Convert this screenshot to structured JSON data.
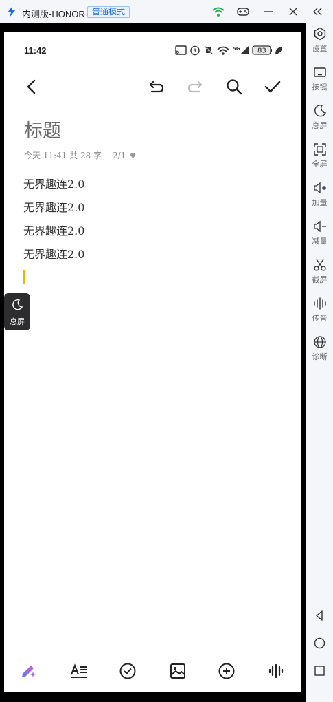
{
  "titlebar": {
    "title": "内测版-HONOR",
    "mode_badge": "普通模式"
  },
  "status_bar": {
    "time": "11:42",
    "battery": "83"
  },
  "note": {
    "title": "标题",
    "meta_time": "今天 11:41",
    "meta_count": "共 28 字",
    "meta_page": "2/1",
    "lines": [
      "无界趣连2.0",
      "无界趣连2.0",
      "无界趣连2.0",
      "无界趣连2.0"
    ]
  },
  "floating_button": {
    "label": "息屏"
  },
  "side_panel": {
    "items": [
      {
        "label": "设置",
        "icon": "settings-icon"
      },
      {
        "label": "按键",
        "icon": "keyboard-icon"
      },
      {
        "label": "息屏",
        "icon": "moon-icon"
      },
      {
        "label": "全屏",
        "icon": "fullscreen-icon"
      },
      {
        "label": "加量",
        "icon": "volume-up-icon"
      },
      {
        "label": "减量",
        "icon": "volume-down-icon"
      },
      {
        "label": "截屏",
        "icon": "scissors-icon"
      },
      {
        "label": "传音",
        "icon": "audio-icon"
      },
      {
        "label": "诊断",
        "icon": "globe-icon"
      }
    ]
  },
  "colors": {
    "accent_cursor": "#f2b400",
    "badge_blue": "#2a6fd6",
    "wifi_green": "#22b04b"
  }
}
